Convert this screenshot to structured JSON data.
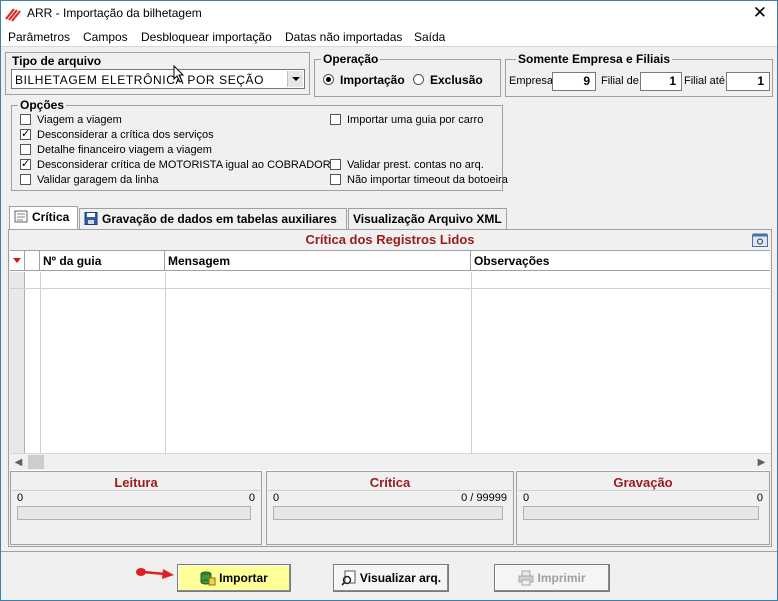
{
  "window": {
    "title": "ARR - Importação da bilhetagem",
    "close_glyph": "✕",
    "app_icon": "arr-logo-icon"
  },
  "menu": [
    "Parâmetros",
    "Campos",
    "Desbloquear importação",
    "Datas não importadas",
    "Saída"
  ],
  "tipo_arquivo": {
    "title": "Tipo de arquivo",
    "value": "BILHETAGEM ELETRÔNICA POR SEÇÃO"
  },
  "operacao": {
    "title": "Operação",
    "options": [
      "Importação",
      "Exclusão"
    ],
    "selected": "Importação"
  },
  "empresa": {
    "title": "Somente Empresa e Filiais",
    "empresa_label": "Empresa",
    "empresa_value": "9",
    "filial_de_label": "Filial de",
    "filial_de_value": "1",
    "filial_ate_label": "Filial até",
    "filial_ate_value": "1"
  },
  "opcoes": {
    "title": "Opções",
    "left": [
      {
        "label": "Viagem a viagem",
        "checked": false
      },
      {
        "label": "Desconsiderar a crítica dos serviços",
        "checked": true
      },
      {
        "label": "Detalhe financeiro viagem a viagem",
        "checked": false
      },
      {
        "label": "Desconsiderar crítica de MOTORISTA igual ao COBRADOR",
        "checked": true
      },
      {
        "label": "Validar garagem da linha",
        "checked": false
      }
    ],
    "right": [
      {
        "label": "Importar uma guia por carro",
        "checked": false
      },
      {
        "label": "Validar prest. contas no arq.",
        "checked": false
      },
      {
        "label": "Não importar timeout da botoeira",
        "checked": false
      }
    ]
  },
  "tabs": [
    {
      "label": "Crítica",
      "icon": "notepad-icon",
      "active": true
    },
    {
      "label": "Gravação de dados em tabelas auxiliares",
      "icon": "floppy-disk-icon",
      "active": false
    },
    {
      "label": "Visualização Arquivo XML",
      "icon": "",
      "active": false
    }
  ],
  "grid": {
    "title": "Crítica dos Registros Lidos",
    "columns": [
      "Nº da guia",
      "Mensagem",
      "Observações"
    ]
  },
  "stats": [
    {
      "title": "Leitura",
      "left": "0",
      "right": "0"
    },
    {
      "title": "Crítica",
      "left": "0",
      "right": "0 / 99999"
    },
    {
      "title": "Gravação",
      "left": "0",
      "right": "0"
    }
  ],
  "buttons": {
    "importar": "Importar",
    "visualizar": "Visualizar arq.",
    "imprimir": "Imprimir"
  },
  "colors": {
    "section_header": "#9b1b1b",
    "highlight_button": "#ffff99",
    "pointer_red": "#e02020"
  }
}
